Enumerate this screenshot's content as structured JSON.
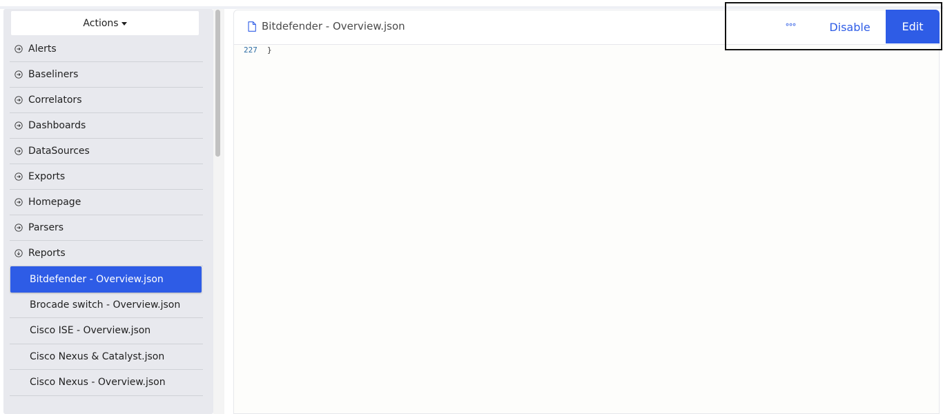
{
  "sidebar": {
    "actions_label": "Actions",
    "items": [
      {
        "label": "Alerts",
        "icon": "circle-arrow-right-icon"
      },
      {
        "label": "Baseliners",
        "icon": "circle-arrow-right-icon"
      },
      {
        "label": "Correlators",
        "icon": "circle-arrow-right-icon"
      },
      {
        "label": "Dashboards",
        "icon": "circle-arrow-right-icon"
      },
      {
        "label": "DataSources",
        "icon": "circle-arrow-right-icon"
      },
      {
        "label": "Exports",
        "icon": "circle-arrow-right-icon"
      },
      {
        "label": "Homepage",
        "icon": "circle-arrow-right-icon"
      },
      {
        "label": "Parsers",
        "icon": "circle-arrow-right-icon"
      },
      {
        "label": "Reports",
        "icon": "circle-arrow-down-icon"
      }
    ],
    "report_files": [
      {
        "label": "Bitdefender - Overview.json",
        "active": true
      },
      {
        "label": "Brocade switch - Overview.json",
        "active": false
      },
      {
        "label": "Cisco ISE - Overview.json",
        "active": false
      },
      {
        "label": "Cisco Nexus & Catalyst.json",
        "active": false
      },
      {
        "label": "Cisco Nexus - Overview.json",
        "active": false
      }
    ]
  },
  "main": {
    "file_title": "Bitdefender - Overview.json",
    "code": {
      "line_number": "227",
      "line_text": "}"
    }
  },
  "toolbar": {
    "more_label": "°°°",
    "disable_label": "Disable",
    "edit_label": "Edit"
  },
  "colors": {
    "accent": "#2e5ce6",
    "sidebar_bg": "#e8e9ee"
  }
}
